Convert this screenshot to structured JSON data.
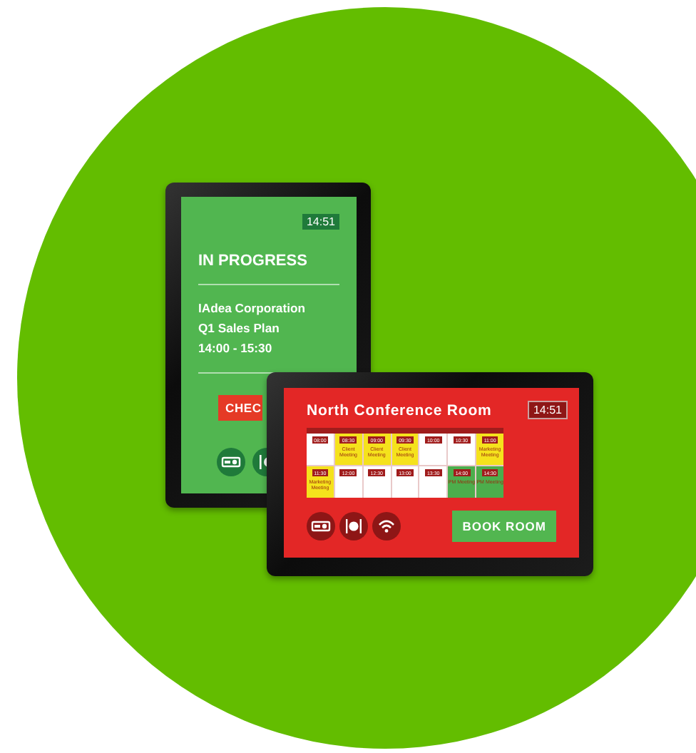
{
  "portrait_tablet": {
    "time": "14:51",
    "status": "IN PROGRESS",
    "organizer": "IAdea Corporation",
    "meeting": "Q1 Sales Plan",
    "time_range": "14:00 - 15:30",
    "button": "CHEC"
  },
  "landscape_tablet": {
    "room": "North Conference Room",
    "time": "14:51",
    "slots": [
      {
        "time": "08:00",
        "kind": "free"
      },
      {
        "time": "08:30",
        "kind": "booked",
        "meeting": "Client Meeting"
      },
      {
        "time": "09:00",
        "kind": "booked",
        "meeting": "Client Meeting"
      },
      {
        "time": "09:30",
        "kind": "booked",
        "meeting": "Client Meeting"
      },
      {
        "time": "10:00",
        "kind": "free"
      },
      {
        "time": "10:30",
        "kind": "free"
      },
      {
        "time": "11:00",
        "kind": "booked",
        "meeting": "Marketing Meeting"
      },
      {
        "time": "11:30",
        "kind": "booked",
        "meeting": "Marketing Meeting"
      },
      {
        "time": "12:00",
        "kind": "free"
      },
      {
        "time": "12:30",
        "kind": "free"
      },
      {
        "time": "13:00",
        "kind": "free"
      },
      {
        "time": "13:30",
        "kind": "free"
      },
      {
        "time": "14:00",
        "kind": "current",
        "meeting": "PM Meeting"
      },
      {
        "time": "14:30",
        "kind": "current",
        "meeting": "PM Meeting"
      }
    ],
    "button": "BOOK ROOM"
  }
}
